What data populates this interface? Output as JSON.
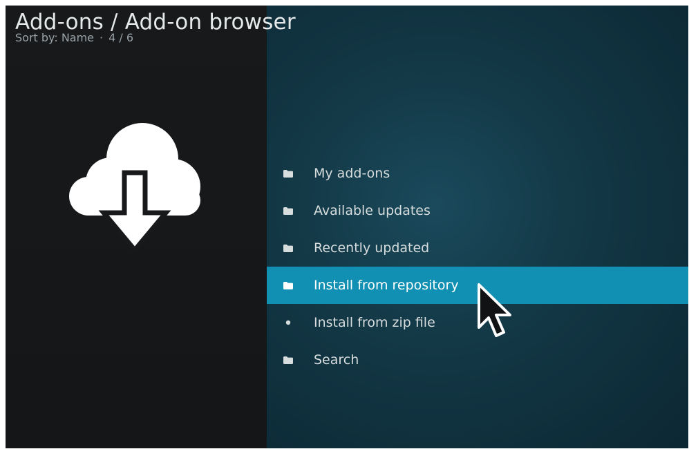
{
  "header": {
    "title": "Add-ons / Add-on browser",
    "sort_label": "Sort by: Name",
    "separator": "·",
    "position": "4 / 6"
  },
  "left_panel": {
    "icon": "cloud-download-icon"
  },
  "menu": {
    "selected_index": 3,
    "items": [
      {
        "label": "My add-ons",
        "icon": "folder-icon"
      },
      {
        "label": "Available updates",
        "icon": "folder-icon"
      },
      {
        "label": "Recently updated",
        "icon": "folder-icon"
      },
      {
        "label": "Install from repository",
        "icon": "folder-icon"
      },
      {
        "label": "Install from zip file",
        "icon": "dot-icon"
      },
      {
        "label": "Search",
        "icon": "folder-icon"
      }
    ]
  },
  "colors": {
    "selection": "#1190b3",
    "left_panel_bg": "#151719",
    "right_panel_bg": "#133846",
    "text": "#d7dcdd"
  },
  "pointer": "mouse-cursor-icon"
}
